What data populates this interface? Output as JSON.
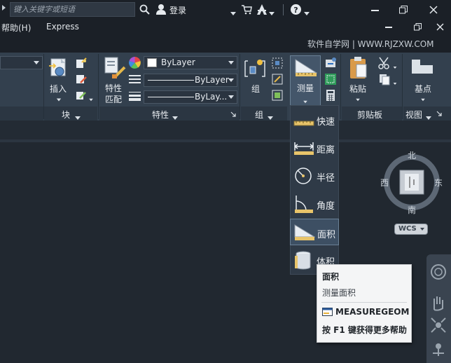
{
  "search": {
    "placeholder": "键入关键字或短语"
  },
  "account": {
    "login": "登录"
  },
  "menu": {
    "help": "帮助(H)",
    "express": "Express"
  },
  "watermark": "软件自学网 | WWW.RJZXW.COM",
  "ribbon": {
    "block": {
      "insert": "插入",
      "footer": "块"
    },
    "properties": {
      "match_line1": "特性",
      "match_line2": "匹配",
      "color": "ByLayer",
      "linetype": "ByLayer",
      "lineweight": "ByLay...",
      "footer": "特性"
    },
    "groups": {
      "group": "组",
      "footer": "组"
    },
    "utilities": {
      "measure": "测量"
    },
    "clipboard": {
      "paste": "粘贴",
      "footer": "剪贴板"
    },
    "view": {
      "base": "基点",
      "footer": "视图"
    }
  },
  "measure_menu": {
    "items": [
      {
        "label": "快速",
        "icon": "quick-measure-icon"
      },
      {
        "label": "距离",
        "icon": "distance-icon"
      },
      {
        "label": "半径",
        "icon": "radius-icon"
      },
      {
        "label": "角度",
        "icon": "angle-icon"
      },
      {
        "label": "面积",
        "icon": "area-icon",
        "selected": true
      },
      {
        "label": "体积",
        "icon": "volume-icon"
      }
    ]
  },
  "tooltip": {
    "title": "面积",
    "description": "测量面积",
    "command": "MEASUREGEOM",
    "help": "按 F1 键获得更多帮助"
  },
  "viewcube": {
    "north": "北",
    "south": "南",
    "east": "东",
    "west": "西",
    "ucs": "WCS"
  },
  "colors": {
    "ribbon": "#33404e",
    "canvas": "#212830",
    "tooltip": "#f4f5f6"
  }
}
